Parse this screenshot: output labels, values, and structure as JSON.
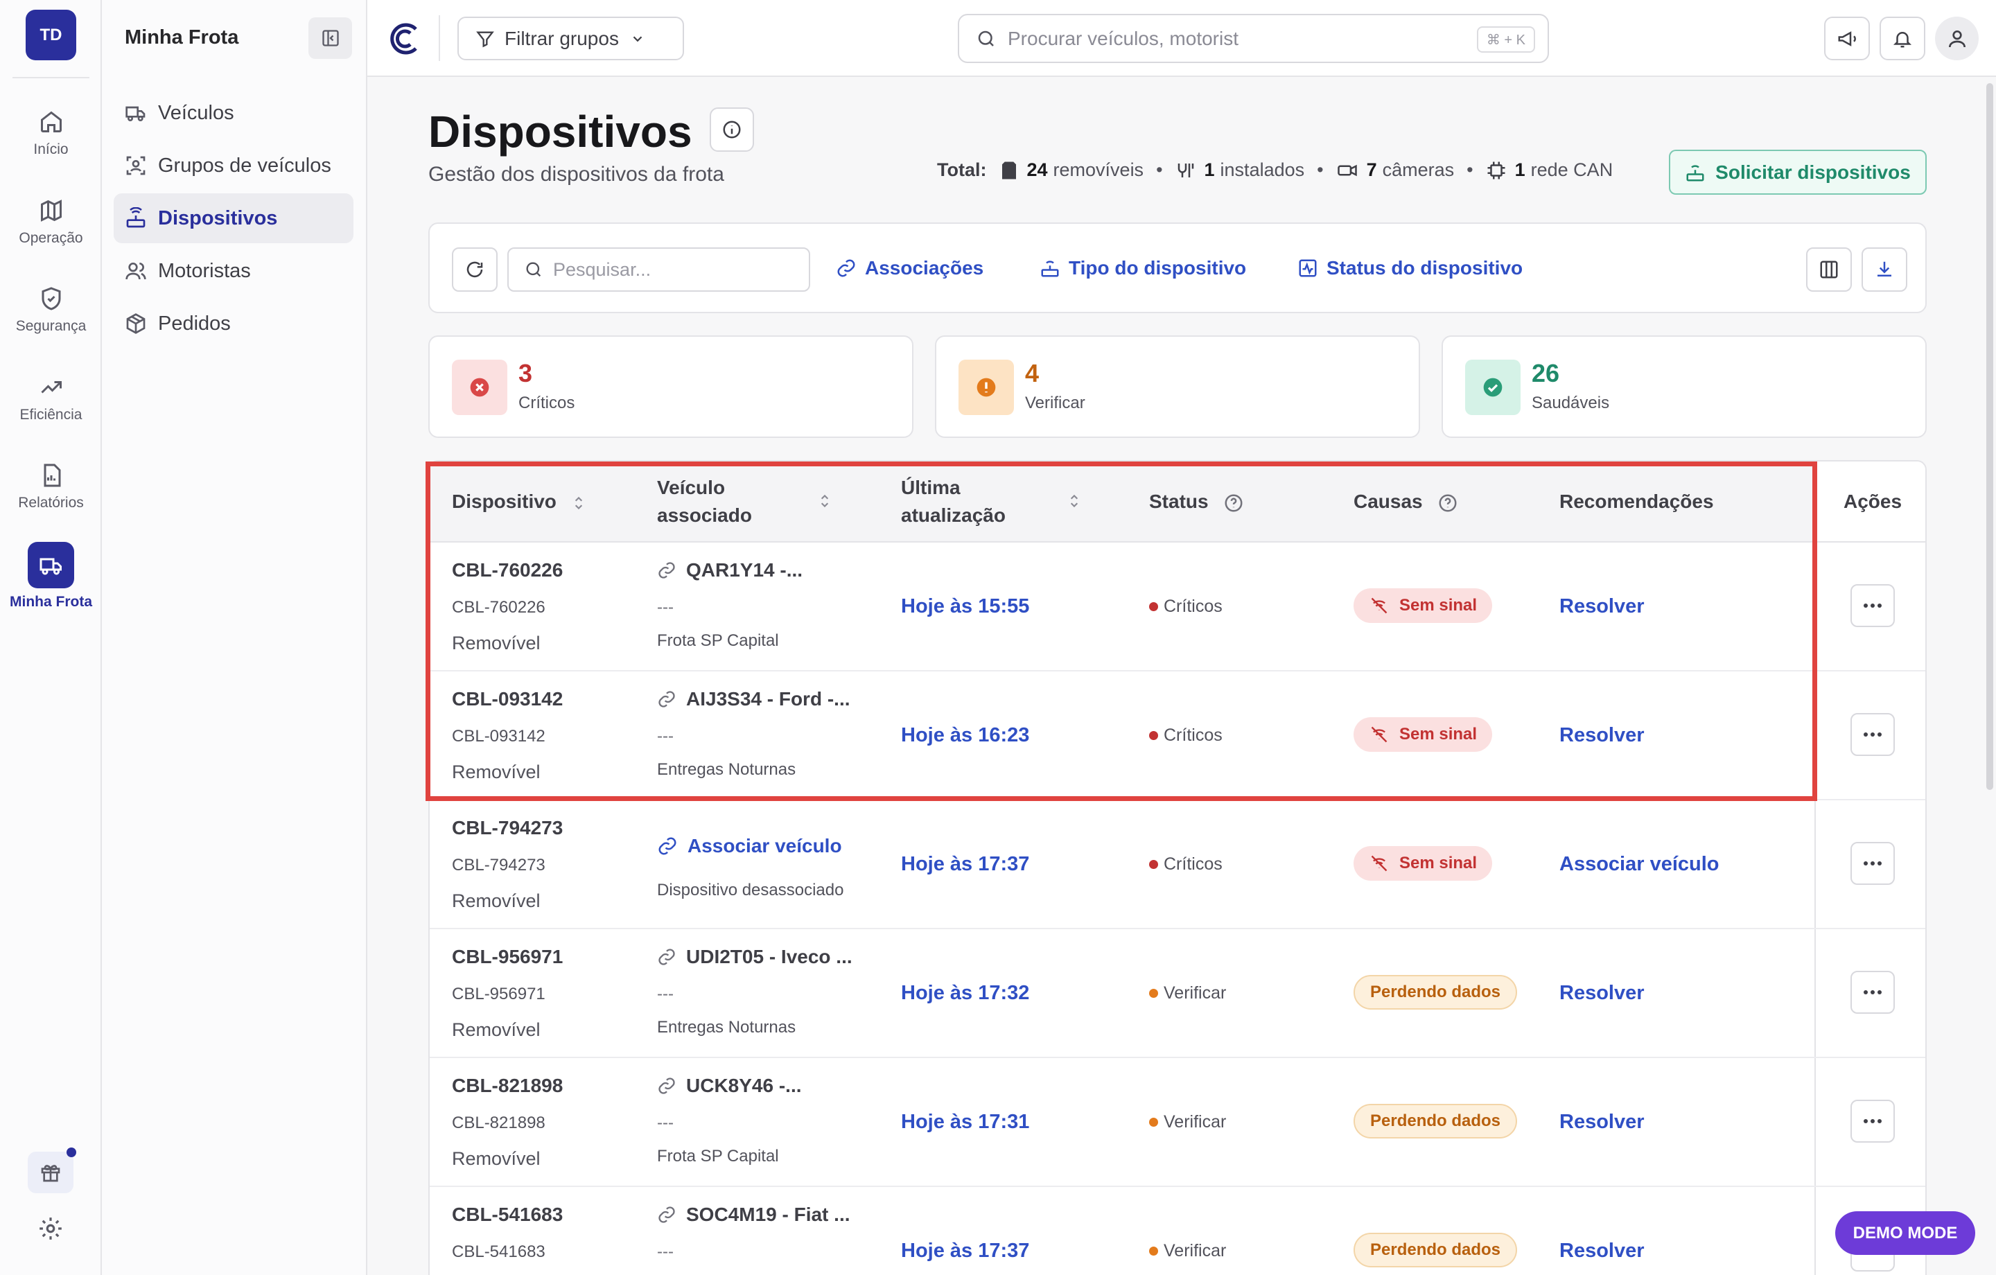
{
  "user": {
    "initials": "TD"
  },
  "rail": [
    {
      "label": "Início",
      "icon": "home-icon"
    },
    {
      "label": "Operação",
      "icon": "map-icon"
    },
    {
      "label": "Segurança",
      "icon": "shield-icon"
    },
    {
      "label": "Eficiência",
      "icon": "trend-icon"
    },
    {
      "label": "Relatórios",
      "icon": "report-icon"
    },
    {
      "label": "Minha Frota",
      "icon": "truck-icon",
      "active": true
    }
  ],
  "sidebar": {
    "title": "Minha Frota",
    "items": [
      {
        "label": "Veículos",
        "icon": "truck-icon"
      },
      {
        "label": "Grupos de veículos",
        "icon": "group-icon"
      },
      {
        "label": "Dispositivos",
        "icon": "router-icon",
        "active": true
      },
      {
        "label": "Motoristas",
        "icon": "users-icon"
      },
      {
        "label": "Pedidos",
        "icon": "box-icon"
      }
    ]
  },
  "topbar": {
    "filter_label": "Filtrar grupos",
    "search_placeholder": "Procurar veículos, motorist",
    "shortcut": "⌘ + K"
  },
  "page": {
    "title": "Dispositivos",
    "subtitle": "Gestão dos dispositivos da frota",
    "totals_label": "Total:",
    "totals": [
      {
        "count": "24",
        "label": "removíveis"
      },
      {
        "count": "1",
        "label": "instalados"
      },
      {
        "count": "7",
        "label": "câmeras"
      },
      {
        "count": "1",
        "label": "rede CAN"
      }
    ],
    "request_button": "Solicitar dispositivos"
  },
  "toolbar": {
    "search_placeholder": "Pesquisar...",
    "associations": "Associações",
    "device_type": "Tipo do dispositivo",
    "device_status": "Status do dispositivo"
  },
  "summary": [
    {
      "count": "3",
      "label": "Críticos",
      "color": "#c23232"
    },
    {
      "count": "4",
      "label": "Verificar",
      "color": "#c2620f"
    },
    {
      "count": "26",
      "label": "Saudáveis",
      "color": "#1f8a6a"
    }
  ],
  "table": {
    "headers": {
      "device": "Dispositivo",
      "vehicle": "Veículo associado",
      "updated": "Última atualização",
      "status": "Status",
      "causes": "Causas",
      "recommendations": "Recomendações",
      "actions": "Ações"
    },
    "rows": [
      {
        "device": "CBL-760226",
        "device_id": "CBL-760226",
        "device_type": "Removível",
        "vehicle": "QAR1Y14 -...",
        "vehicle_sub": "---",
        "group": "Frota SP Capital",
        "updated": "Hoje às 15:55",
        "status": "Críticos",
        "cause": "Sem sinal",
        "recommendation": "Resolver"
      },
      {
        "device": "CBL-093142",
        "device_id": "CBL-093142",
        "device_type": "Removível",
        "vehicle": "AIJ3S34 - Ford -...",
        "vehicle_sub": "---",
        "group": "Entregas Noturnas",
        "updated": "Hoje às 16:23",
        "status": "Críticos",
        "cause": "Sem sinal",
        "recommendation": "Resolver"
      },
      {
        "device": "CBL-794273",
        "device_id": "CBL-794273",
        "device_type": "Removível",
        "vehicle": "Associar veículo",
        "vehicle_sub": "",
        "group": "Dispositivo desassociado",
        "updated": "Hoje às 17:37",
        "status": "Críticos",
        "cause": "Sem sinal",
        "recommendation": "Associar veículo"
      },
      {
        "device": "CBL-956971",
        "device_id": "CBL-956971",
        "device_type": "Removível",
        "vehicle": "UDI2T05 - Iveco ...",
        "vehicle_sub": "---",
        "group": "Entregas Noturnas",
        "updated": "Hoje às 17:32",
        "status": "Verificar",
        "cause": "Perdendo dados",
        "recommendation": "Resolver"
      },
      {
        "device": "CBL-821898",
        "device_id": "CBL-821898",
        "device_type": "Removível",
        "vehicle": "UCK8Y46 -...",
        "vehicle_sub": "---",
        "group": "Frota SP Capital",
        "updated": "Hoje às 17:31",
        "status": "Verificar",
        "cause": "Perdendo dados",
        "recommendation": "Resolver"
      },
      {
        "device": "CBL-541683",
        "device_id": "CBL-541683",
        "device_type": "",
        "vehicle": "SOC4M19 - Fiat ...",
        "vehicle_sub": "---",
        "group": "",
        "updated": "Hoje às 17:37",
        "status": "Verificar",
        "cause": "Perdendo dados",
        "recommendation": "Resolver"
      }
    ]
  },
  "demo_badge": "DEMO MODE"
}
